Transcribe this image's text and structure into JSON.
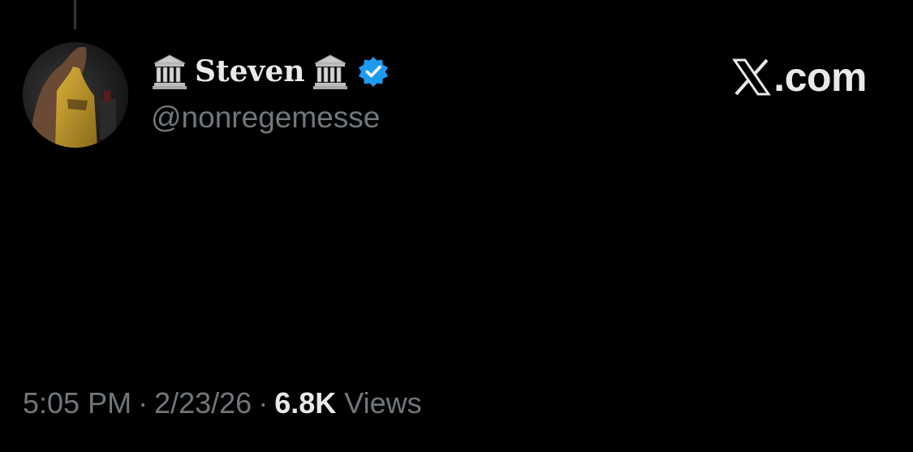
{
  "author": {
    "display_name": "Steven",
    "handle": "@nonregemesse",
    "avatar_icon": "avatar-photo",
    "name_emoji_icon": "classical-building-icon",
    "verified": true,
    "verified_color": "#1d9bf0"
  },
  "brand": {
    "label": ".com",
    "icon": "x-logo-icon"
  },
  "tweet": {
    "text": ""
  },
  "meta": {
    "time": "5:05 PM",
    "date": "2/23/26",
    "views_count": "6.8K",
    "views_label": "Views",
    "separator": "·"
  },
  "colors": {
    "background": "#000000",
    "primary_text": "#e7e9ea",
    "secondary_text": "#71767b",
    "accent": "#1d9bf0"
  }
}
